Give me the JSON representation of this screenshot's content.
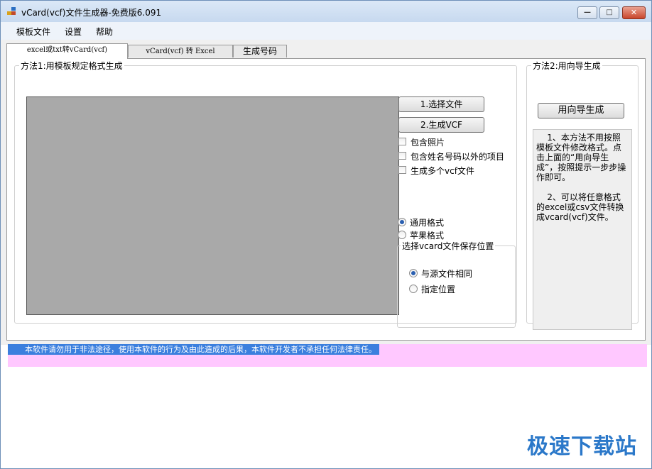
{
  "window": {
    "title": "vCard(vcf)文件生成器-免费版6.091",
    "controls": {
      "minimize": "—",
      "maximize": "□",
      "close": "✕"
    }
  },
  "menu": [
    "模板文件",
    "设置",
    "帮助"
  ],
  "tabs": [
    {
      "label": "excel或txt转vCard(vcf)",
      "active": true
    },
    {
      "label": "vCard(vcf) 转 Excel",
      "active": false
    },
    {
      "label": "生成号码",
      "active": false
    }
  ],
  "method1": {
    "legend": "方法1:用模板规定格式生成",
    "select_file_button": "1.选择文件",
    "generate_button": "2.生成VCF",
    "checkboxes": [
      {
        "label": "包含照片",
        "checked": false
      },
      {
        "label": "包含姓名号码以外的项目",
        "checked": false
      },
      {
        "label": "生成多个vcf文件",
        "checked": false
      }
    ],
    "format_radios": [
      {
        "label": "通用格式",
        "checked": true
      },
      {
        "label": "苹果格式",
        "checked": false
      }
    ],
    "save_location": {
      "legend": "选择vcard文件保存位置",
      "options": [
        {
          "label": "与源文件相同",
          "checked": true
        },
        {
          "label": "指定位置",
          "checked": false
        }
      ]
    }
  },
  "method2": {
    "legend": "方法2:用向导生成",
    "wizard_button": "用向导生成",
    "notes": "    1、本方法不用按照模板文件修改格式。点击上面的“用向导生成”，按照提示一步步操作即可。\n\n    2、可以将任意格式的excel或csv文件转换成vcard(vcf)文件。"
  },
  "status": {
    "disclaimer": "本软件请勿用于非法途径，使用本软件的行为及由此造成的后果，本软件开发者不承担任何法律责任。"
  },
  "watermark": "极速下载站",
  "colors": {
    "titlebar": "#c7d9ef",
    "status_bg": "#ffc8ff",
    "status_text_bg": "#3b7fde",
    "watermark": "#2b78c9"
  }
}
